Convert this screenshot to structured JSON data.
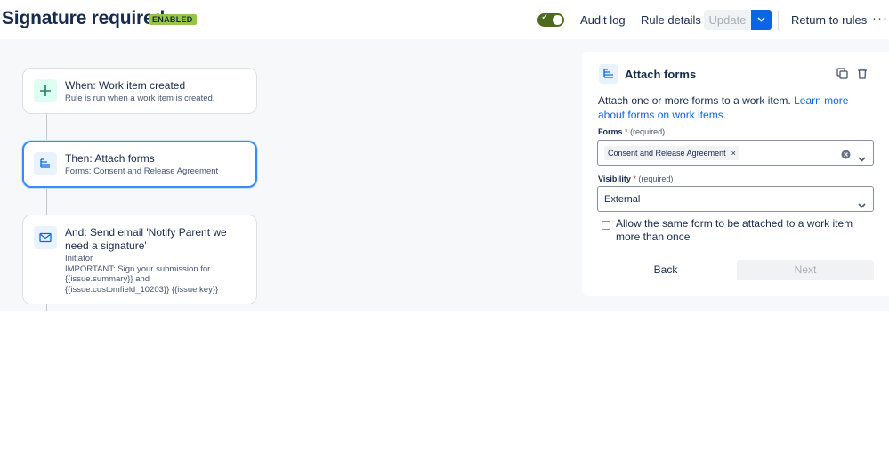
{
  "header": {
    "title": "Signature required",
    "status_badge": "ENABLED",
    "audit_log": "Audit log",
    "rule_details": "Rule details",
    "update": "Update",
    "return_to_rules": "Return to rules",
    "more": "···"
  },
  "colors": {
    "accent": "#0c66e4",
    "enabled_badge": "#94c748",
    "toggle_on": "#4c6b1f",
    "selected_border": "#388bff"
  },
  "flow": {
    "trigger": {
      "icon": "plus-icon",
      "title": "When: Work item created",
      "subtitle": "Rule is run when a work item is created."
    },
    "action": {
      "icon": "form-icon",
      "title": "Then: Attach forms",
      "subtitle": "Forms: Consent and Release Agreement"
    },
    "email": {
      "icon": "mail-icon",
      "title": "And: Send email 'Notify Parent we need a signature'",
      "line1": "Initiator",
      "line2": "IMPORTANT: Sign your submission for",
      "line3": "{{issue.summary}} and",
      "line4": "{{issue.customfield_10203}} {{issue.key}}"
    }
  },
  "panel": {
    "icon": "form-icon",
    "title": "Attach forms",
    "description": "Attach one or more forms to a work item.",
    "learn_more": "Learn more about forms on work items.",
    "forms_label": "Forms",
    "forms_required_mark": "*",
    "forms_hint": "(required)",
    "forms_selected": "Consent and Release Agreement",
    "chip_remove": "×",
    "visibility_label": "Visibility",
    "visibility_required_mark": "*",
    "visibility_hint": "(required)",
    "visibility_value": "External",
    "allow_duplicate_label": "Allow the same form to be attached to a work item more than once",
    "allow_duplicate_checked": false,
    "back": "Back",
    "next": "Next"
  }
}
